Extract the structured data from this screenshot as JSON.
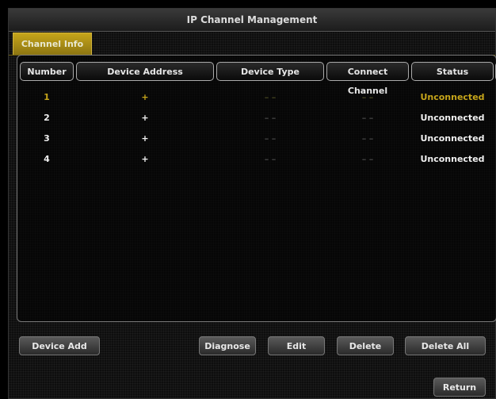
{
  "window": {
    "title": "IP Channel Management"
  },
  "tabs": {
    "active": "Channel Info"
  },
  "table": {
    "headers": [
      "Number",
      "Device Address",
      "Device Type",
      "Connect Channel",
      "Status"
    ],
    "rows": [
      {
        "number": "1",
        "address": "+",
        "type": "– –",
        "channel": "– –",
        "status": "Unconnected"
      },
      {
        "number": "2",
        "address": "+",
        "type": "– –",
        "channel": "– –",
        "status": "Unconnected"
      },
      {
        "number": "3",
        "address": "+",
        "type": "– –",
        "channel": "– –",
        "status": "Unconnected"
      },
      {
        "number": "4",
        "address": "+",
        "type": "– –",
        "channel": "– –",
        "status": "Unconnected"
      }
    ]
  },
  "buttons": {
    "device_add": "Device Add",
    "diagnose": "Diagnose",
    "edit": "Edit",
    "delete": "Delete",
    "delete_all": "Delete All",
    "return": "Return"
  }
}
